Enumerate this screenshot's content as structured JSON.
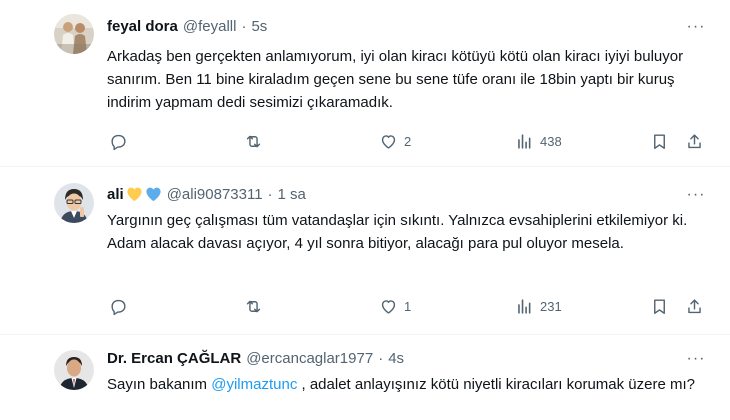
{
  "tweets": [
    {
      "name": "feyal dora",
      "handle": "@feyalll",
      "time": "5s",
      "text": "Arkadaş ben gerçekten anlamıyorum, iyi olan kiracı kötüyü kötü olan kiracı iyiyi buluyor sanırım.  Ben 11 bine kiraladım geçen sene bu sene tüfe oranı ile 18bin yaptı bir kuruş indirim yapmam dedi sesimizi çıkaramadık.",
      "replies": "",
      "retweets": "",
      "likes": "2",
      "views": "438",
      "more_label": "···"
    },
    {
      "name": "ali",
      "name_emojis": [
        "yellow-heart",
        "blue-heart"
      ],
      "handle": "@ali90873311",
      "time": "1 sa",
      "text": "Yargının geç çalışması tüm vatandaşlar için sıkıntı. Yalnızca evsahiplerini etkilemiyor ki. Adam alacak davası açıyor, 4 yıl sonra bitiyor, alacağı para pul oluyor mesela.",
      "replies": "",
      "retweets": "",
      "likes": "1",
      "views": "231",
      "more_label": "···"
    },
    {
      "name": "Dr. Ercan ÇAĞLAR",
      "handle": "@ercancaglar1977",
      "time": "4s",
      "text_before": "Sayın bakanım ",
      "mention": "@yilmaztunc",
      "text_after": " , adalet anlayışınız kötü niyetli kiracıları korumak üzere mı?",
      "more_label": "···"
    }
  ],
  "separator": "·",
  "icons": [
    "reply-icon",
    "retweet-icon",
    "like-icon",
    "views-icon",
    "bookmark-icon",
    "share-icon"
  ],
  "colors": {
    "text": "#0f1419",
    "secondary": "#536471",
    "link": "#1d9bf0",
    "divider": "#eff3f4"
  }
}
